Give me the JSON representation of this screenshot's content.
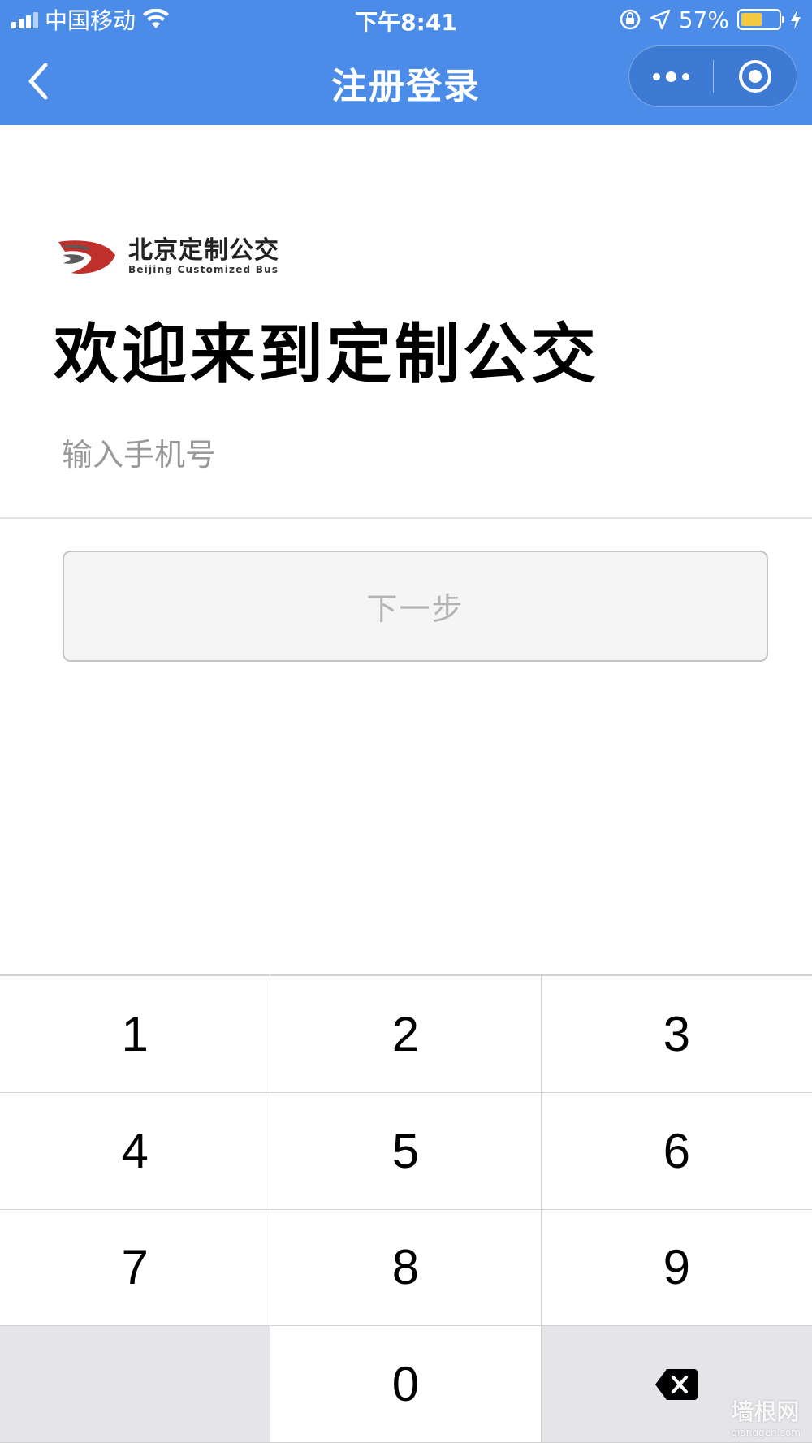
{
  "status_bar": {
    "carrier": "中国移动",
    "time": "下午8:41",
    "battery_percent": "57%",
    "battery_level": 0.57,
    "icons": [
      "signal-icon",
      "wifi-icon",
      "orientation-lock-icon",
      "location-arrow-icon",
      "battery-icon",
      "charging-bolt-icon"
    ]
  },
  "nav": {
    "title": "注册登录",
    "back_icon": "chevron-left-icon",
    "menu_icon": "more-dots-icon",
    "close_icon": "target-close-icon"
  },
  "logo": {
    "name": "北京定制公交",
    "subtitle": "Beijing Customized Bus"
  },
  "welcome": "欢迎来到定制公交",
  "phone_input": {
    "placeholder": "输入手机号",
    "value": ""
  },
  "next_button": "下一步",
  "keypad": {
    "keys": [
      "1",
      "2",
      "3",
      "4",
      "5",
      "6",
      "7",
      "8",
      "9",
      "",
      "0",
      "⌫"
    ]
  },
  "watermark": {
    "text": "墙根网",
    "url": "qianggen.com"
  },
  "colors": {
    "nav_bg": "#4a8ce8",
    "logo_red": "#c0302a",
    "logo_gray": "#5b5b5b",
    "battery_fill": "#f5c842",
    "keypad_gray": "#e4e4e9"
  }
}
